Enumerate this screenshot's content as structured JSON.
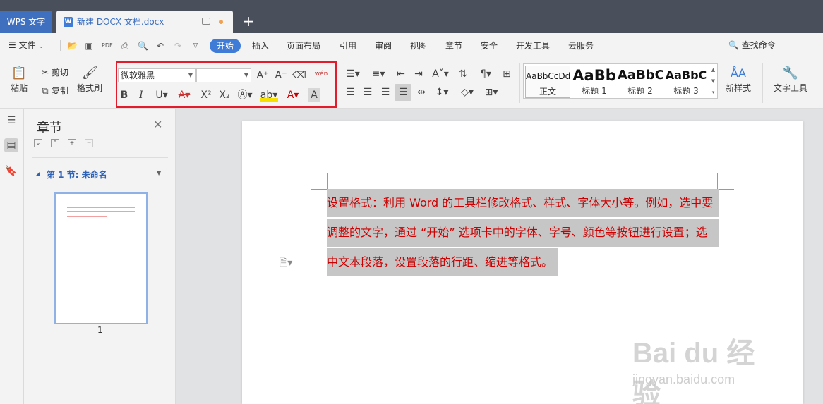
{
  "tabs": {
    "app": "WPS 文字",
    "document": "新建 DOCX 文档.docx",
    "add": "+"
  },
  "menubar": {
    "file": "文件",
    "items": [
      "开始",
      "插入",
      "页面布局",
      "引用",
      "审阅",
      "视图",
      "章节",
      "安全",
      "开发工具",
      "云服务"
    ],
    "active": "开始",
    "search": "查找命令"
  },
  "ribbon": {
    "paste": "粘贴",
    "cut": "剪切",
    "copy": "复制",
    "format_painter": "格式刷",
    "font_name": "微软雅黑",
    "font_size": "",
    "pinyin": "wén",
    "new_style": "新样式",
    "text_tools": "文字工具",
    "styles": [
      {
        "sample": "AaBbCcDd",
        "name": "正文"
      },
      {
        "sample": "AaBb",
        "name": "标题 1"
      },
      {
        "sample": "AaBbC",
        "name": "标题 2"
      },
      {
        "sample": "AaBbC",
        "name": "标题 3"
      }
    ]
  },
  "pane": {
    "title": "章节",
    "section": "第 1 节: 未命名",
    "page_number": "1"
  },
  "document": {
    "lines": [
      "设置格式：利用 Word 的工具栏修改格式、样式、字体大小等。例如，选中要",
      "调整的文字，通过 “开始” 选项卡中的字体、字号、颜色等按钮进行设置；选",
      "中文本段落，设置段落的行距、缩进等格式。"
    ]
  },
  "watermark": {
    "main": "Bai du 经验",
    "sub": "jingyan.baidu.com"
  },
  "colors": {
    "accent": "#3e7cd7",
    "highlight_border": "#e21c2a",
    "doc_text": "#cc0000"
  }
}
